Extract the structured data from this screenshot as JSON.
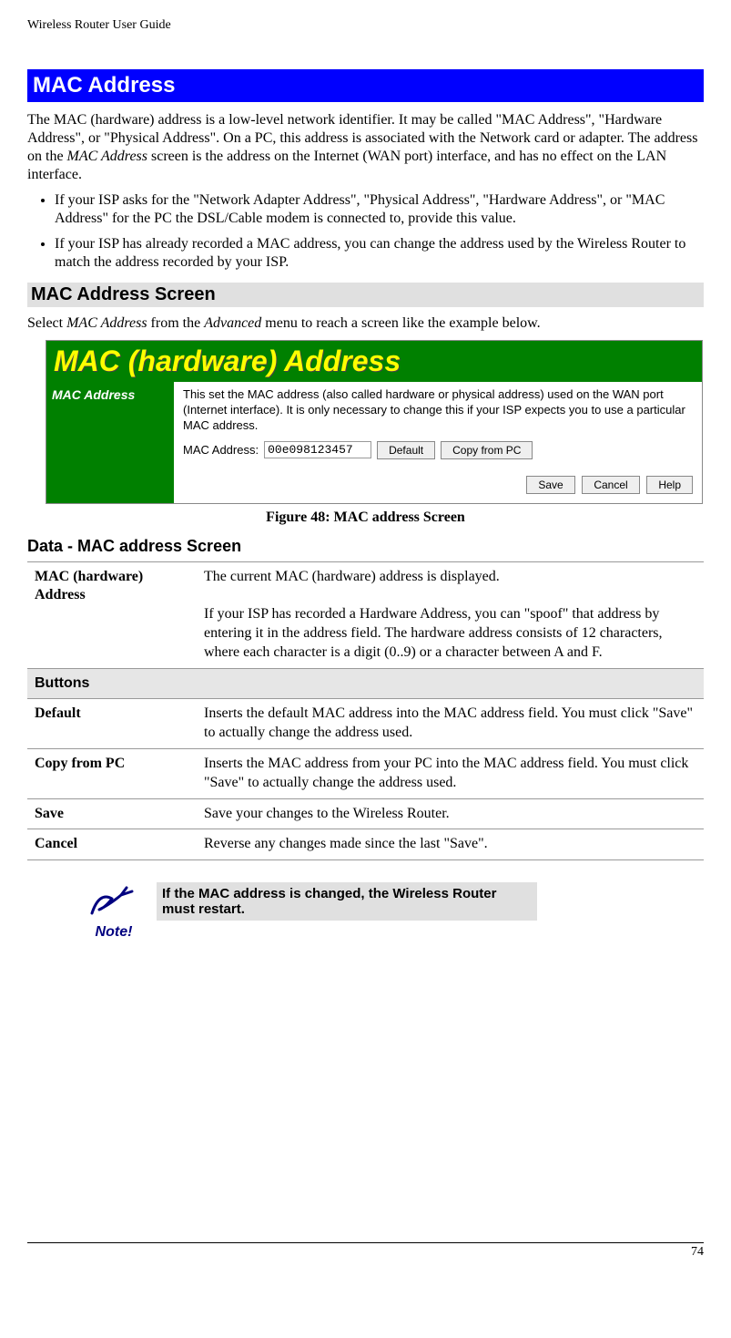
{
  "running_header": "Wireless Router User Guide",
  "title": "MAC Address",
  "intro": "The MAC (hardware) address is a low-level network identifier. It may be called \"MAC Address\", \"Hardware Address\", or \"Physical Address\". On a PC, this address is associated with the Network card or adapter. The address on the ",
  "intro_italic": "MAC Address",
  "intro_tail": " screen is the address on the Internet (WAN port) interface, and has no effect on the LAN interface.",
  "bullets": [
    "If your ISP asks for the \"Network Adapter Address\", \"Physical Address\", \"Hardware Address\", or \"MAC Address\" for the PC the DSL/Cable modem is connected to, provide this value.",
    "If your ISP has already recorded a MAC address, you can change the address used by the Wireless Router to match the address recorded by your ISP."
  ],
  "section1_heading": "MAC Address Screen",
  "section1_text_a": "Select ",
  "section1_text_b": "MAC Address",
  "section1_text_c": " from the ",
  "section1_text_d": "Advanced",
  "section1_text_e": " menu to reach a screen like the example below.",
  "app": {
    "title": "MAC (hardware) Address",
    "side_label": "MAC Address",
    "desc": "This set the MAC address (also called hardware or physical address) used on the WAN port (Internet interface). It is only necessary to change this if your ISP expects you to use a particular MAC address.",
    "field_label": "MAC Address:",
    "field_value": "00e098123457",
    "btn_default": "Default",
    "btn_copy": "Copy from PC",
    "btn_save": "Save",
    "btn_cancel": "Cancel",
    "btn_help": "Help"
  },
  "figure_caption": "Figure 48: MAC address Screen",
  "data_heading": "Data - MAC address Screen",
  "table": {
    "r1k": "MAC (hardware) Address",
    "r1v": "The current MAC (hardware) address is displayed.\n\nIf your ISP has recorded a Hardware Address, you can \"spoof\" that address by entering it in the address field. The hardware address consists of 12 characters, where each character is a digit (0..9) or a character between A and F.",
    "section": "Buttons",
    "r2k": "Default",
    "r2v": "Inserts the default MAC address into the MAC address field. You must click \"Save\" to actually change the address used.",
    "r3k": "Copy from PC",
    "r3v": "Inserts the MAC address from your PC into the MAC address field. You must click \"Save\" to actually change the address used.",
    "r4k": "Save",
    "r4v": "Save your changes to the Wireless Router.",
    "r5k": "Cancel",
    "r5v": "Reverse any changes made since the last \"Save\"."
  },
  "note_label": "Note!",
  "note_text": "If the MAC address is changed, the Wireless Router must restart.",
  "page_number": "74"
}
